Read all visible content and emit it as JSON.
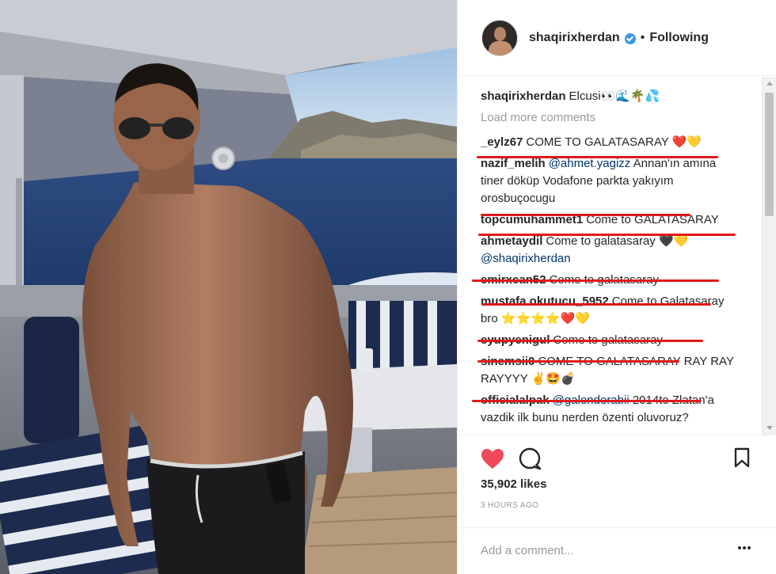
{
  "header": {
    "username": "shaqirixherdan",
    "separator": "•",
    "follow_status": "Following"
  },
  "comments": {
    "load_more": "Load more comments",
    "items": [
      {
        "user": "shaqirixherdan",
        "text": "Elcusi👀🌊🌴💦",
        "highlighted": false
      },
      {
        "user": "_eylz67",
        "text": "COME TO GALATASARAY ❤️💛",
        "highlighted": true
      },
      {
        "user": "nazif_melih",
        "mention": "@ahmet.yagizz",
        "text": "Annan'ın amına tiner döküp Vodafone parkta yakıyım orosbuçocugu",
        "highlighted": true
      },
      {
        "user": "topcumuhammet1",
        "text": "Come to GALATASARAY",
        "highlighted": true
      },
      {
        "user": "ahmetaydil",
        "text": "Come to galatasaray 🖤💛",
        "mention_after": "@shaqirixherdan",
        "highlighted": true
      },
      {
        "user": "emirxcan52",
        "text": "Come to galatasaray",
        "highlighted": true
      },
      {
        "user": "mustafa.okutucu_5952",
        "text": "Come to Galatasaray bro ⭐⭐⭐⭐❤️💛",
        "highlighted": true
      },
      {
        "user": "eyupyenigul",
        "text": "Come to galatasaray",
        "highlighted": true
      },
      {
        "user": "sinemsii0",
        "text": "COME TO GALATASARAY RAY RAY RAYYYY ✌️🤩💣",
        "highlighted": true
      },
      {
        "user": "officialalpak",
        "mention": "@galenderabii",
        "text": "2014te Zlatan'a vazdik ilk bunu nerden özenti oluvoruz?",
        "highlighted": false
      }
    ]
  },
  "actions": {
    "likes": "35,902 likes",
    "time": "3 HOURS AGO",
    "comment_placeholder": "Add a comment...",
    "icons": [
      "heart-icon",
      "comment-icon",
      "bookmark-icon",
      "more-options-icon"
    ]
  },
  "colors": {
    "like_red": "#ed4956",
    "highlight_red": "#e0191a",
    "verified_blue": "#3897f0",
    "mention_blue": "#003569"
  }
}
